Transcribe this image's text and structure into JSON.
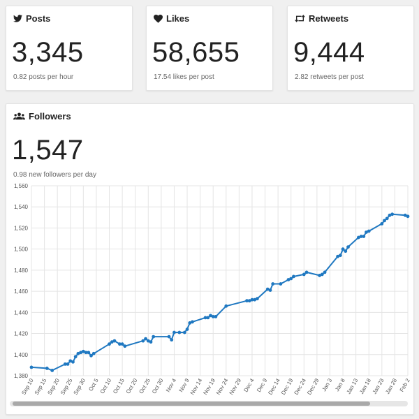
{
  "stats": {
    "posts": {
      "title": "Posts",
      "value": "3,345",
      "sub": "0.82 posts per hour",
      "icon": "twitter-bird-icon"
    },
    "likes": {
      "title": "Likes",
      "value": "58,655",
      "sub": "17.54 likes per post",
      "icon": "heart-icon"
    },
    "retweets": {
      "title": "Retweets",
      "value": "9,444",
      "sub": "2.82 retweets per post",
      "icon": "retweet-icon"
    }
  },
  "followers": {
    "title": "Followers",
    "value": "1,547",
    "sub": "0.98 new followers per day",
    "icon": "users-icon"
  },
  "colors": {
    "line": "#1f78c1",
    "grid": "#e4e4e4"
  },
  "chart_data": {
    "type": "line",
    "title": "",
    "xlabel": "",
    "ylabel": "",
    "ylim": [
      1380,
      1560
    ],
    "yticks": [
      1380,
      1400,
      1420,
      1440,
      1460,
      1480,
      1500,
      1520,
      1540,
      1560
    ],
    "ytick_labels": [
      "1,380",
      "1,400",
      "1,420",
      "1,440",
      "1,460",
      "1,480",
      "1,500",
      "1,520",
      "1,540",
      "1,560"
    ],
    "xticks": [
      "Sep 10",
      "Sep 15",
      "Sep 20",
      "Sep 25",
      "Sep 30",
      "Oct 5",
      "Oct 10",
      "Oct 15",
      "Oct 20",
      "Oct 25",
      "Oct 30",
      "Nov 4",
      "Nov 9",
      "Nov 14",
      "Nov 19",
      "Nov 24",
      "Nov 29",
      "Dec 4",
      "Dec 9",
      "Dec 14",
      "Dec 19",
      "Dec 24",
      "Dec 29",
      "Jan 3",
      "Jan 8",
      "Jan 13",
      "Jan 18",
      "Jan 23",
      "Jan 28",
      "Feb 2"
    ],
    "grid": true,
    "legend": "none",
    "series": [
      {
        "points": [
          [
            "Sep 10",
            1388
          ],
          [
            "Sep 16",
            1387
          ],
          [
            "Sep 18",
            1385
          ],
          [
            "Sep 23",
            1391
          ],
          [
            "Sep 24",
            1391
          ],
          [
            "Sep 25",
            1394
          ],
          [
            "Sep 26",
            1393
          ],
          [
            "Sep 27",
            1398
          ],
          [
            "Sep 28",
            1401
          ],
          [
            "Sep 29",
            1402
          ],
          [
            "Sep 30",
            1403
          ],
          [
            "Oct 1",
            1402
          ],
          [
            "Oct 2",
            1402
          ],
          [
            "Oct 3",
            1399
          ],
          [
            "Oct 4",
            1401
          ],
          [
            "Oct 10",
            1410
          ],
          [
            "Oct 11",
            1412
          ],
          [
            "Oct 12",
            1413
          ],
          [
            "Oct 14",
            1410
          ],
          [
            "Oct 15",
            1410
          ],
          [
            "Oct 16",
            1408
          ],
          [
            "Oct 23",
            1413
          ],
          [
            "Oct 24",
            1415
          ],
          [
            "Oct 25",
            1413
          ],
          [
            "Oct 26",
            1412
          ],
          [
            "Oct 27",
            1417
          ],
          [
            "Nov 2",
            1417
          ],
          [
            "Nov 3",
            1414
          ],
          [
            "Nov 4",
            1421
          ],
          [
            "Nov 6",
            1421
          ],
          [
            "Nov 8",
            1421
          ],
          [
            "Nov 9",
            1424
          ],
          [
            "Nov 10",
            1430
          ],
          [
            "Nov 11",
            1431
          ],
          [
            "Nov 16",
            1435
          ],
          [
            "Nov 17",
            1435
          ],
          [
            "Nov 18",
            1437
          ],
          [
            "Nov 19",
            1436
          ],
          [
            "Nov 20",
            1436
          ],
          [
            "Nov 24",
            1446
          ],
          [
            "Dec 2",
            1451
          ],
          [
            "Dec 3",
            1451
          ],
          [
            "Dec 4",
            1452
          ],
          [
            "Dec 5",
            1452
          ],
          [
            "Dec 6",
            1453
          ],
          [
            "Dec 10",
            1462
          ],
          [
            "Dec 11",
            1461
          ],
          [
            "Dec 12",
            1467
          ],
          [
            "Dec 15",
            1467
          ],
          [
            "Dec 18",
            1471
          ],
          [
            "Dec 19",
            1472
          ],
          [
            "Dec 20",
            1474
          ],
          [
            "Dec 24",
            1476
          ],
          [
            "Dec 25",
            1478
          ],
          [
            "Dec 30",
            1475
          ],
          [
            "Dec 31",
            1476
          ],
          [
            "Jan 1",
            1478
          ],
          [
            "Jan 6",
            1493
          ],
          [
            "Jan 7",
            1494
          ],
          [
            "Jan 8",
            1500
          ],
          [
            "Jan 9",
            1498
          ],
          [
            "Jan 10",
            1502
          ],
          [
            "Jan 14",
            1511
          ],
          [
            "Jan 15",
            1512
          ],
          [
            "Jan 16",
            1512
          ],
          [
            "Jan 17",
            1516
          ],
          [
            "Jan 18",
            1517
          ],
          [
            "Jan 23",
            1524
          ],
          [
            "Jan 24",
            1527
          ],
          [
            "Jan 25",
            1529
          ],
          [
            "Jan 26",
            1532
          ],
          [
            "Jan 27",
            1533
          ],
          [
            "Feb 1",
            1532
          ],
          [
            "Feb 2",
            1531
          ]
        ]
      }
    ]
  }
}
